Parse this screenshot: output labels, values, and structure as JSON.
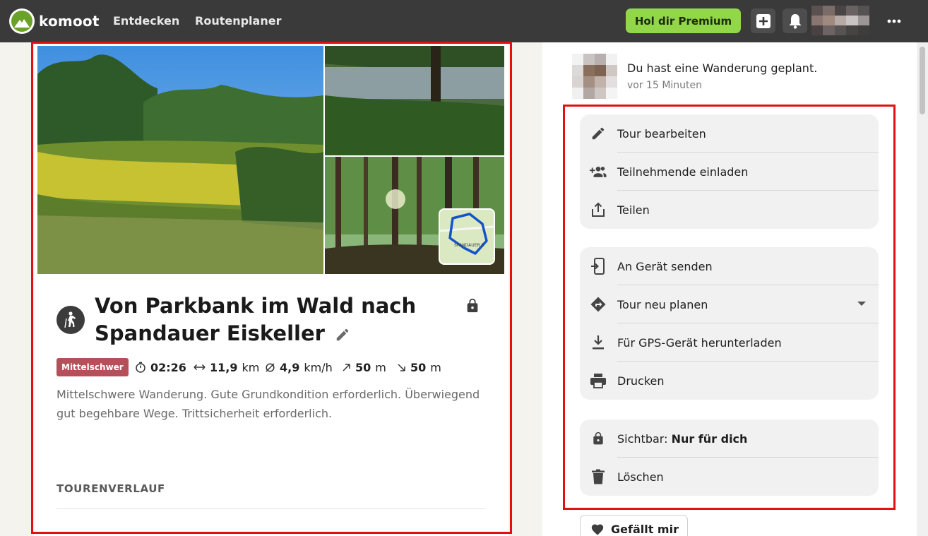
{
  "nav": {
    "brand": "komoot",
    "links": [
      "Entdecken",
      "Routenplaner"
    ],
    "premium_label": "Hol dir Premium"
  },
  "tour": {
    "title": "Von Parkbank im Wald nach Spandauer Eiskeller",
    "difficulty": "Mittelschwer",
    "duration": "02:26",
    "distance_value": "11,9",
    "distance_unit": "km",
    "speed_value": "4,9",
    "speed_unit": "km/h",
    "ascent_value": "50",
    "ascent_unit": "m",
    "descent_value": "50",
    "descent_unit": "m",
    "description": "Mittelschwere Wanderung. Gute Grundkondition erforderlich. Überwiegend gut begehbare Wege. Trittsicherheit erforderlich.",
    "section_label": "TOURENVERLAUF",
    "map_label": "SPANDAUER S"
  },
  "activity": {
    "text": "Du hast eine Wanderung geplant.",
    "time": "vor 15 Minuten"
  },
  "menu": {
    "group1": [
      {
        "label": "Tour bearbeiten",
        "icon": "pencil-icon"
      },
      {
        "label": "Teilnehmende einladen",
        "icon": "add-people-icon"
      },
      {
        "label": "Teilen",
        "icon": "share-icon"
      }
    ],
    "group2": [
      {
        "label": "An Gerät senden",
        "icon": "send-to-device-icon"
      },
      {
        "label": "Tour neu planen",
        "icon": "directions-icon"
      },
      {
        "label": "Für GPS-Gerät herunterladen",
        "icon": "download-icon"
      },
      {
        "label": "Drucken",
        "icon": "printer-icon"
      }
    ],
    "visibility_prefix": "Sichtbar:",
    "visibility_value": "Nur für dich",
    "delete_label": "Löschen"
  },
  "like_label": "Gefällt mir",
  "colors": {
    "nav_bg": "#3a3a3a",
    "premium_green": "#92d64a",
    "difficulty_bg": "#b54f59",
    "highlight_red": "#e21111",
    "menu_bg": "#f1f1f1"
  }
}
